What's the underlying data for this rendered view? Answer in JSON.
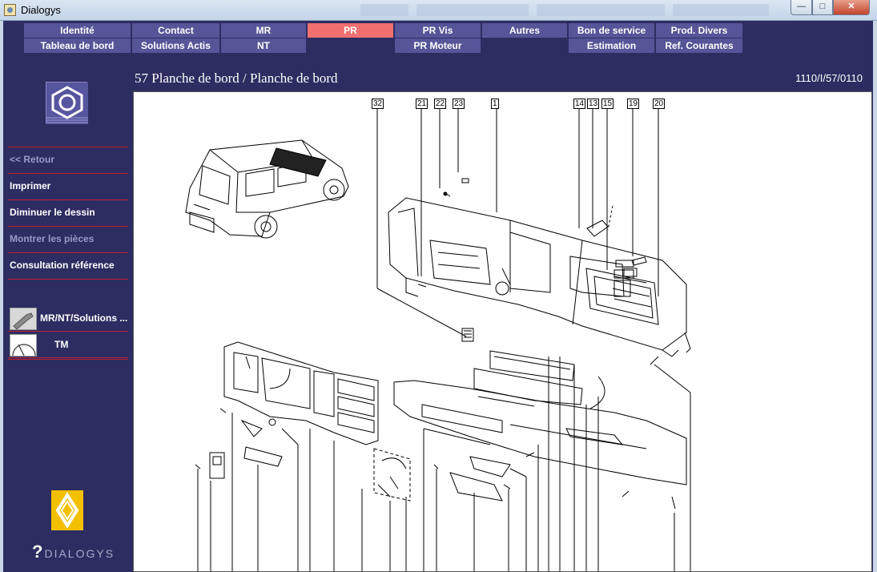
{
  "window": {
    "title": "Dialogys",
    "minimize": "—",
    "maximize": "□",
    "close": "✕"
  },
  "menu_row1": [
    {
      "label": "Identité"
    },
    {
      "label": "Contact"
    },
    {
      "label": "MR"
    },
    {
      "label": "PR",
      "active": true
    },
    {
      "label": "PR Vis"
    },
    {
      "label": "Autres"
    },
    {
      "label": "Bon de service"
    },
    {
      "label": "Prod. Divers"
    }
  ],
  "menu_row2": [
    {
      "label": "Tableau de bord"
    },
    {
      "label": "Solutions Actis"
    },
    {
      "label": "NT"
    },
    {
      "label": ""
    },
    {
      "label": "PR Moteur"
    },
    {
      "label": ""
    },
    {
      "label": "Estimation"
    },
    {
      "label": "Ref. Courantes"
    }
  ],
  "sidebar": {
    "items": [
      {
        "label": "<< Retour",
        "enabled": false
      },
      {
        "label": "Imprimer",
        "enabled": true
      },
      {
        "label": "Diminuer le dessin",
        "enabled": true
      },
      {
        "label": "Montrer les pièces",
        "enabled": false
      },
      {
        "label": "Consultation référence",
        "enabled": true
      }
    ],
    "shortcuts": [
      {
        "label": "MR/NT/Solutions ..."
      },
      {
        "label": "TM"
      }
    ],
    "brand": "DIALOGYS"
  },
  "header": {
    "title": "57 Planche de bord / Planche de bord",
    "reference": "1110/I/57/0110"
  },
  "drawing": {
    "callouts": [
      "32",
      "21",
      "22",
      "23",
      "1",
      "14",
      "13",
      "15",
      "19",
      "20"
    ]
  }
}
